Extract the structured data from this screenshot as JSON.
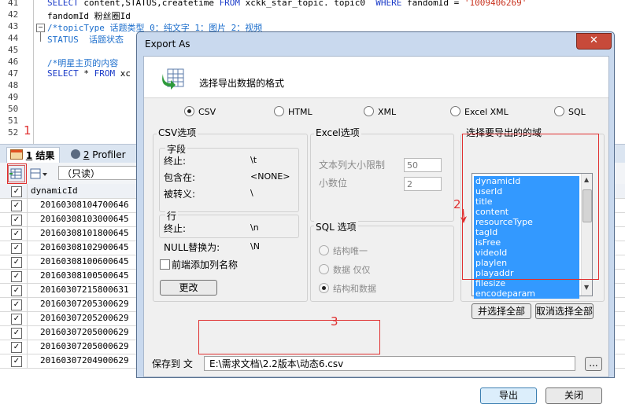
{
  "editor": {
    "line_numbers": [
      "41",
      "42",
      "43",
      "44",
      "45",
      "46",
      "47",
      "48",
      "49",
      "50",
      "51",
      "52"
    ],
    "line41": {
      "k1": "SELECT",
      "t1": " content,STATUS,createtime ",
      "k2": "FROM",
      "t2": " xckk_star_topic. topic0  ",
      "k3": "WHERE",
      "t3": " fandomId = ",
      "s1": "'1009406269'"
    },
    "line42": "fandomId 粉丝圈Id",
    "line43": "/*topicType 话题类型 0：纯文字 1：图片 2：视频",
    "line44": "STATUS  话题状态",
    "line46": "/*明星主页的内容",
    "line47": {
      "k1": "SELECT",
      "t1": " * ",
      "k2": "FROM",
      "t2": " xc"
    }
  },
  "results": {
    "tab1_num": "1",
    "tab1_label": "结果",
    "tab2_num": "2",
    "tab2_label": "Profiler",
    "readonly_label": "（只读）",
    "column_header": "dynamicId",
    "rows": [
      "20160308104700646",
      "20160308103000645",
      "20160308101800645",
      "20160308102900645",
      "20160308100600645",
      "20160308100500645",
      "20160307215800631",
      "20160307205300629",
      "20160307205200629",
      "20160307205000629",
      "20160307205000629",
      "20160307204900629"
    ]
  },
  "dialog": {
    "title": "Export As",
    "close_glyph": "✕",
    "format_heading": "选择导出数据的格式",
    "formats": [
      "CSV",
      "HTML",
      "XML",
      "Excel XML",
      "SQL"
    ],
    "selected_format": "CSV",
    "csv": {
      "group_title": "CSV选项",
      "field_section": "字段",
      "terminated_label": "终止:",
      "terminated_value": "\\t",
      "enclosed_label": "包含在:",
      "enclosed_value": "<NONE>",
      "escaped_label": "被转义:",
      "escaped_value": "\\",
      "line_section": "行",
      "line_terminated_label": "终止:",
      "line_terminated_value": "\\n",
      "null_label": "NULL替换为:",
      "null_value": "\\N",
      "add_header_label": "前端添加列名称",
      "change_button": "更改"
    },
    "excel": {
      "group_title": "Excel选项",
      "text_col_label": "文本列大小限制",
      "text_col_value": "50",
      "decimal_label": "小数位",
      "decimal_value": "2"
    },
    "sql": {
      "group_title": "SQL 选项",
      "options": [
        "结构唯一",
        "数据 仅仅",
        "结构和数据"
      ],
      "selected": "结构和数据"
    },
    "fields": {
      "group_title": "选择要导出的的域",
      "items": [
        "dynamicId",
        "userId",
        "title",
        "content",
        "resourceType",
        "tagId",
        "isFree",
        "videoId",
        "playlen",
        "playaddr",
        "filesize",
        "encodeparam"
      ],
      "select_all_button": "并选择全部",
      "deselect_all_button": "取消选择全部"
    },
    "save_label": "保存到 文",
    "save_path": "E:\\需求文档\\2.2版本\\动态6.csv",
    "browse_button": "...",
    "export_button": "导出",
    "close_button": "关闭"
  },
  "annotations": [
    "1",
    "2",
    "3"
  ],
  "colors": {
    "dialog_frame": "#c9d9ee",
    "selection": "#3399ff",
    "annotation": "#e03030",
    "close_button": "#c74a3a"
  }
}
